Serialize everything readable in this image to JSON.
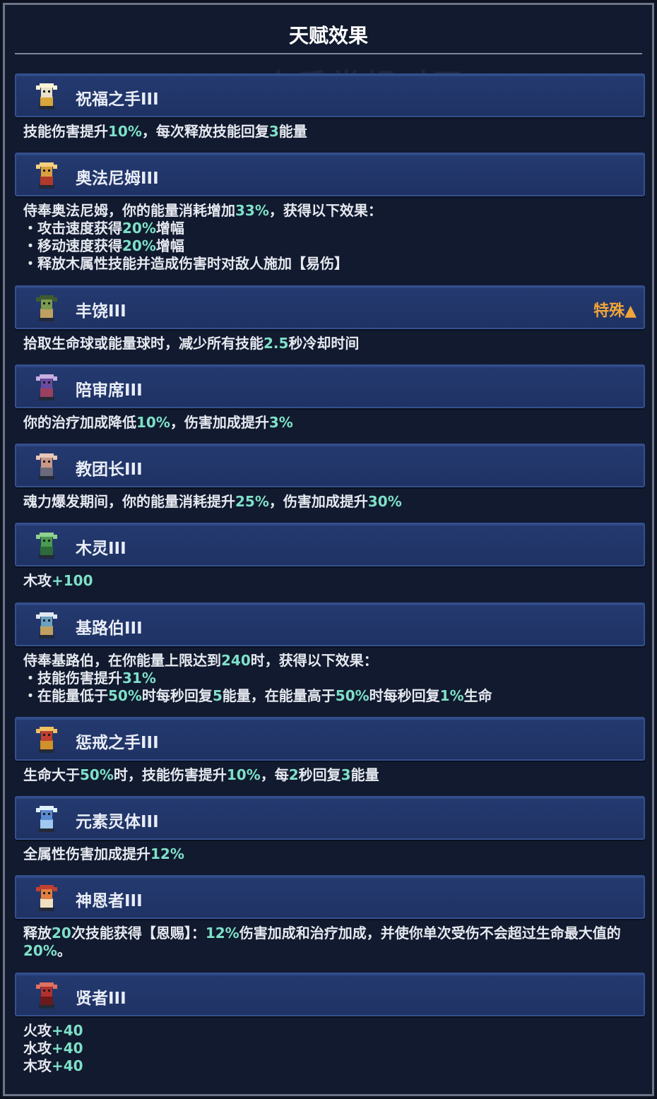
{
  "panel": {
    "title": "天赋效果",
    "background_text": "木系常规对王"
  },
  "talents": [
    {
      "name": "祝福之手III",
      "icon": "white-gold-hand-icon",
      "tag": "",
      "desc": "技能伤害提升10%，每次释放技能回复3能量"
    },
    {
      "name": "奥法尼姆III",
      "icon": "gold-red-wheel-icon",
      "tag": "",
      "desc": "侍奉奥法尼姆，你的能量消耗增加33%，获得以下效果：\n・攻击速度获得20%增幅\n・移动速度获得20%增幅\n・释放木属性技能并造成伤害时对敌人施加【易伤】"
    },
    {
      "name": "丰饶III",
      "icon": "green-horned-icon",
      "tag": "特殊▲",
      "desc": "拾取生命球或能量球时，减少所有技能2.5秒冷却时间"
    },
    {
      "name": "陪审席III",
      "icon": "purple-judge-icon",
      "tag": "",
      "desc": "你的治疗加成降低10%，伤害加成提升3%"
    },
    {
      "name": "教团长III",
      "icon": "bald-elder-icon",
      "tag": "",
      "desc": "魂力爆发期间，你的能量消耗提升25%，伤害加成提升30%"
    },
    {
      "name": "木灵III",
      "icon": "green-spirit-icon",
      "tag": "",
      "desc": "木攻+100"
    },
    {
      "name": "基路伯III",
      "icon": "cherub-icon",
      "tag": "",
      "desc": "侍奉基路伯，在你能量上限达到240时，获得以下效果：\n・技能伤害提升31%\n・在能量低于50%时每秒回复5能量，在能量高于50%时每秒回复1%生命"
    },
    {
      "name": "惩戒之手III",
      "icon": "red-gold-hand-icon",
      "tag": "",
      "desc": "生命大于50%时，技能伤害提升10%，每2秒回复3能量"
    },
    {
      "name": "元素灵体III",
      "icon": "blue-wizard-icon",
      "tag": "",
      "desc": "全属性伤害加成提升12%"
    },
    {
      "name": "神恩者III",
      "icon": "winged-orange-icon",
      "tag": "",
      "desc": "释放20次技能获得【恩赐】：12%伤害加成和治疗加成，并使你单次受伤不会超过生命最大值的20%。"
    },
    {
      "name": "贤者III",
      "icon": "red-hood-icon",
      "tag": "",
      "desc": "火攻+40\n水攻+40\n木攻+40"
    }
  ],
  "colors": {
    "accent_text": "#7ee0c8",
    "special_tag": "#f0a43a",
    "row_bg": "#23386c"
  }
}
